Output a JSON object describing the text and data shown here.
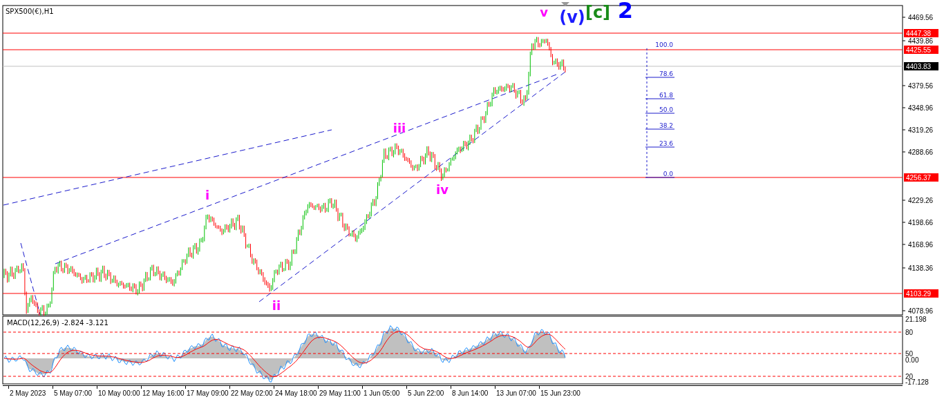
{
  "chart": {
    "symbol": "SPX500(€),H1",
    "price_axis_labels": [
      "4469.56",
      "4439.86",
      "4379.56",
      "4348.96",
      "4319.26",
      "4288.66",
      "4229.26",
      "4198.66",
      "4168.96",
      "4138.36",
      "4078.96"
    ],
    "price_tags": [
      {
        "text": "4447.38",
        "kind": "level"
      },
      {
        "text": "4425.55",
        "kind": "level"
      },
      {
        "text": "4403.83",
        "kind": "bid"
      },
      {
        "text": "4256.37",
        "kind": "level"
      },
      {
        "text": "4103.29",
        "kind": "level"
      }
    ],
    "wave_labels": [
      {
        "text": "i",
        "color": "#ff00ff"
      },
      {
        "text": "ii",
        "color": "#ff00ff"
      },
      {
        "text": "iii",
        "color": "#ff00ff"
      },
      {
        "text": "iv",
        "color": "#ff00ff"
      },
      {
        "text": "v",
        "color": "#ff00ff"
      },
      {
        "text": "(v)",
        "color": "#1c1cff"
      },
      {
        "text": "[c]",
        "color": "#1a8c1a"
      },
      {
        "text": "2",
        "color": "#0000ff"
      }
    ],
    "fib_levels": [
      "100.0",
      "78.6",
      "61.8",
      "50.0",
      "38.2",
      "23.6",
      "0.0"
    ]
  },
  "macd": {
    "title": "MACD(12,26,9) -2.824 -3.121",
    "axis_labels": [
      "21.198",
      "80",
      "50",
      "0.00",
      "20",
      "-17.128"
    ]
  },
  "time_axis": [
    "2 May 2023",
    "5 May 07:00",
    "10 May 00:00",
    "12 May 16:00",
    "17 May 09:00",
    "22 May 02:00",
    "24 May 18:00",
    "29 May 11:00",
    "1 Jun 05:00",
    "5 Jun 22:00",
    "8 Jun 14:00",
    "13 Jun 07:00",
    "15 Jun 23:00"
  ]
}
